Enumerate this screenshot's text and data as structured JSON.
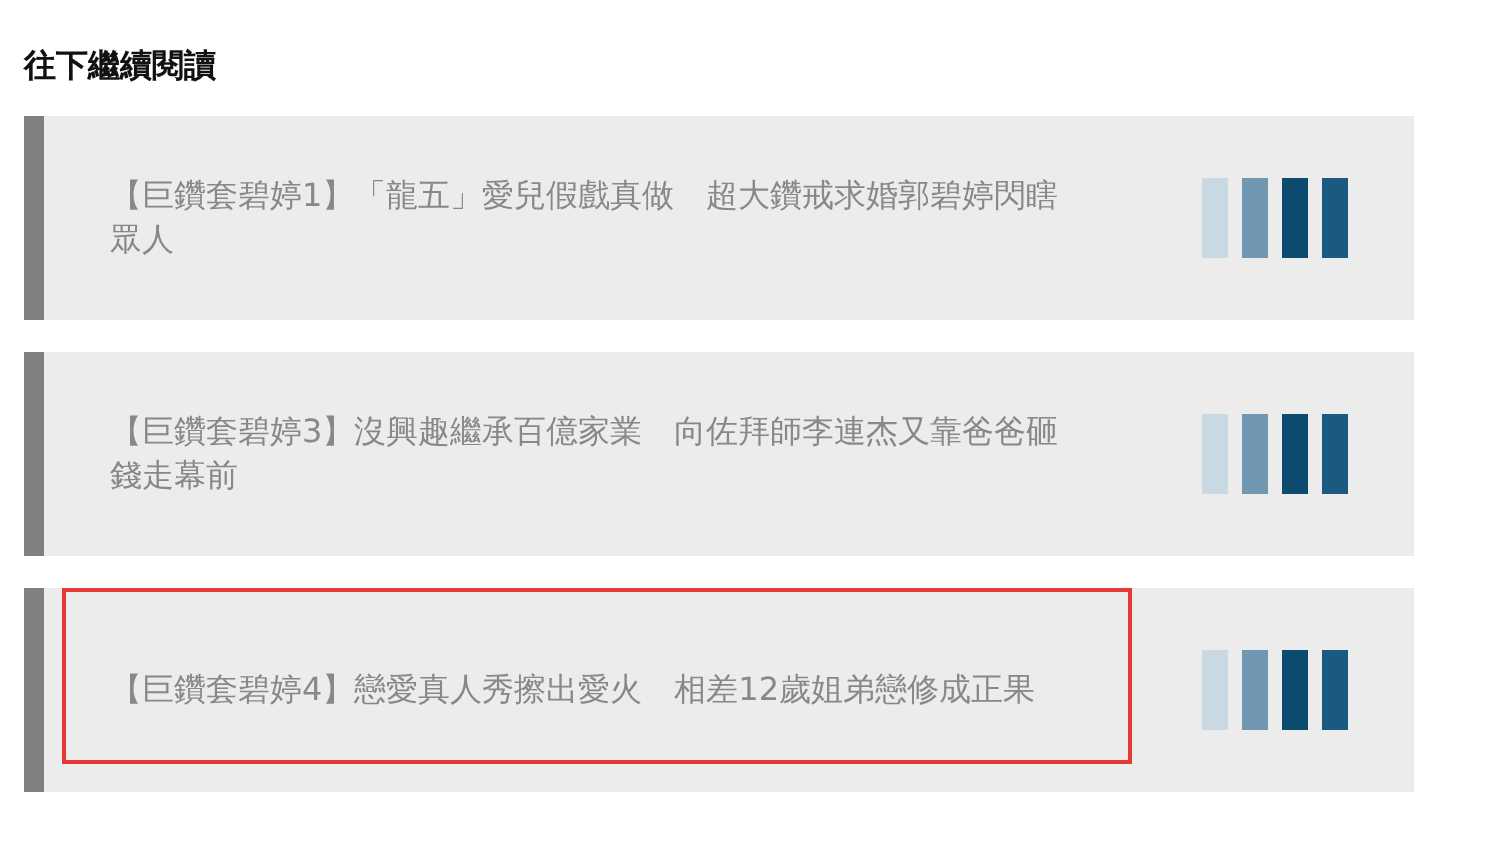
{
  "heading": "往下繼續閱讀",
  "articles": [
    {
      "title": "【巨鑽套碧婷1】「龍五」愛兒假戲真做　超大鑽戒求婚郭碧婷閃瞎眾人",
      "highlighted": false
    },
    {
      "title": "【巨鑽套碧婷3】沒興趣繼承百億家業　向佐拜師李連杰又靠爸爸砸錢走幕前",
      "highlighted": false
    },
    {
      "title": "【巨鑽套碧婷4】戀愛真人秀擦出愛火　相差12歲姐弟戀修成正果",
      "highlighted": true
    }
  ]
}
